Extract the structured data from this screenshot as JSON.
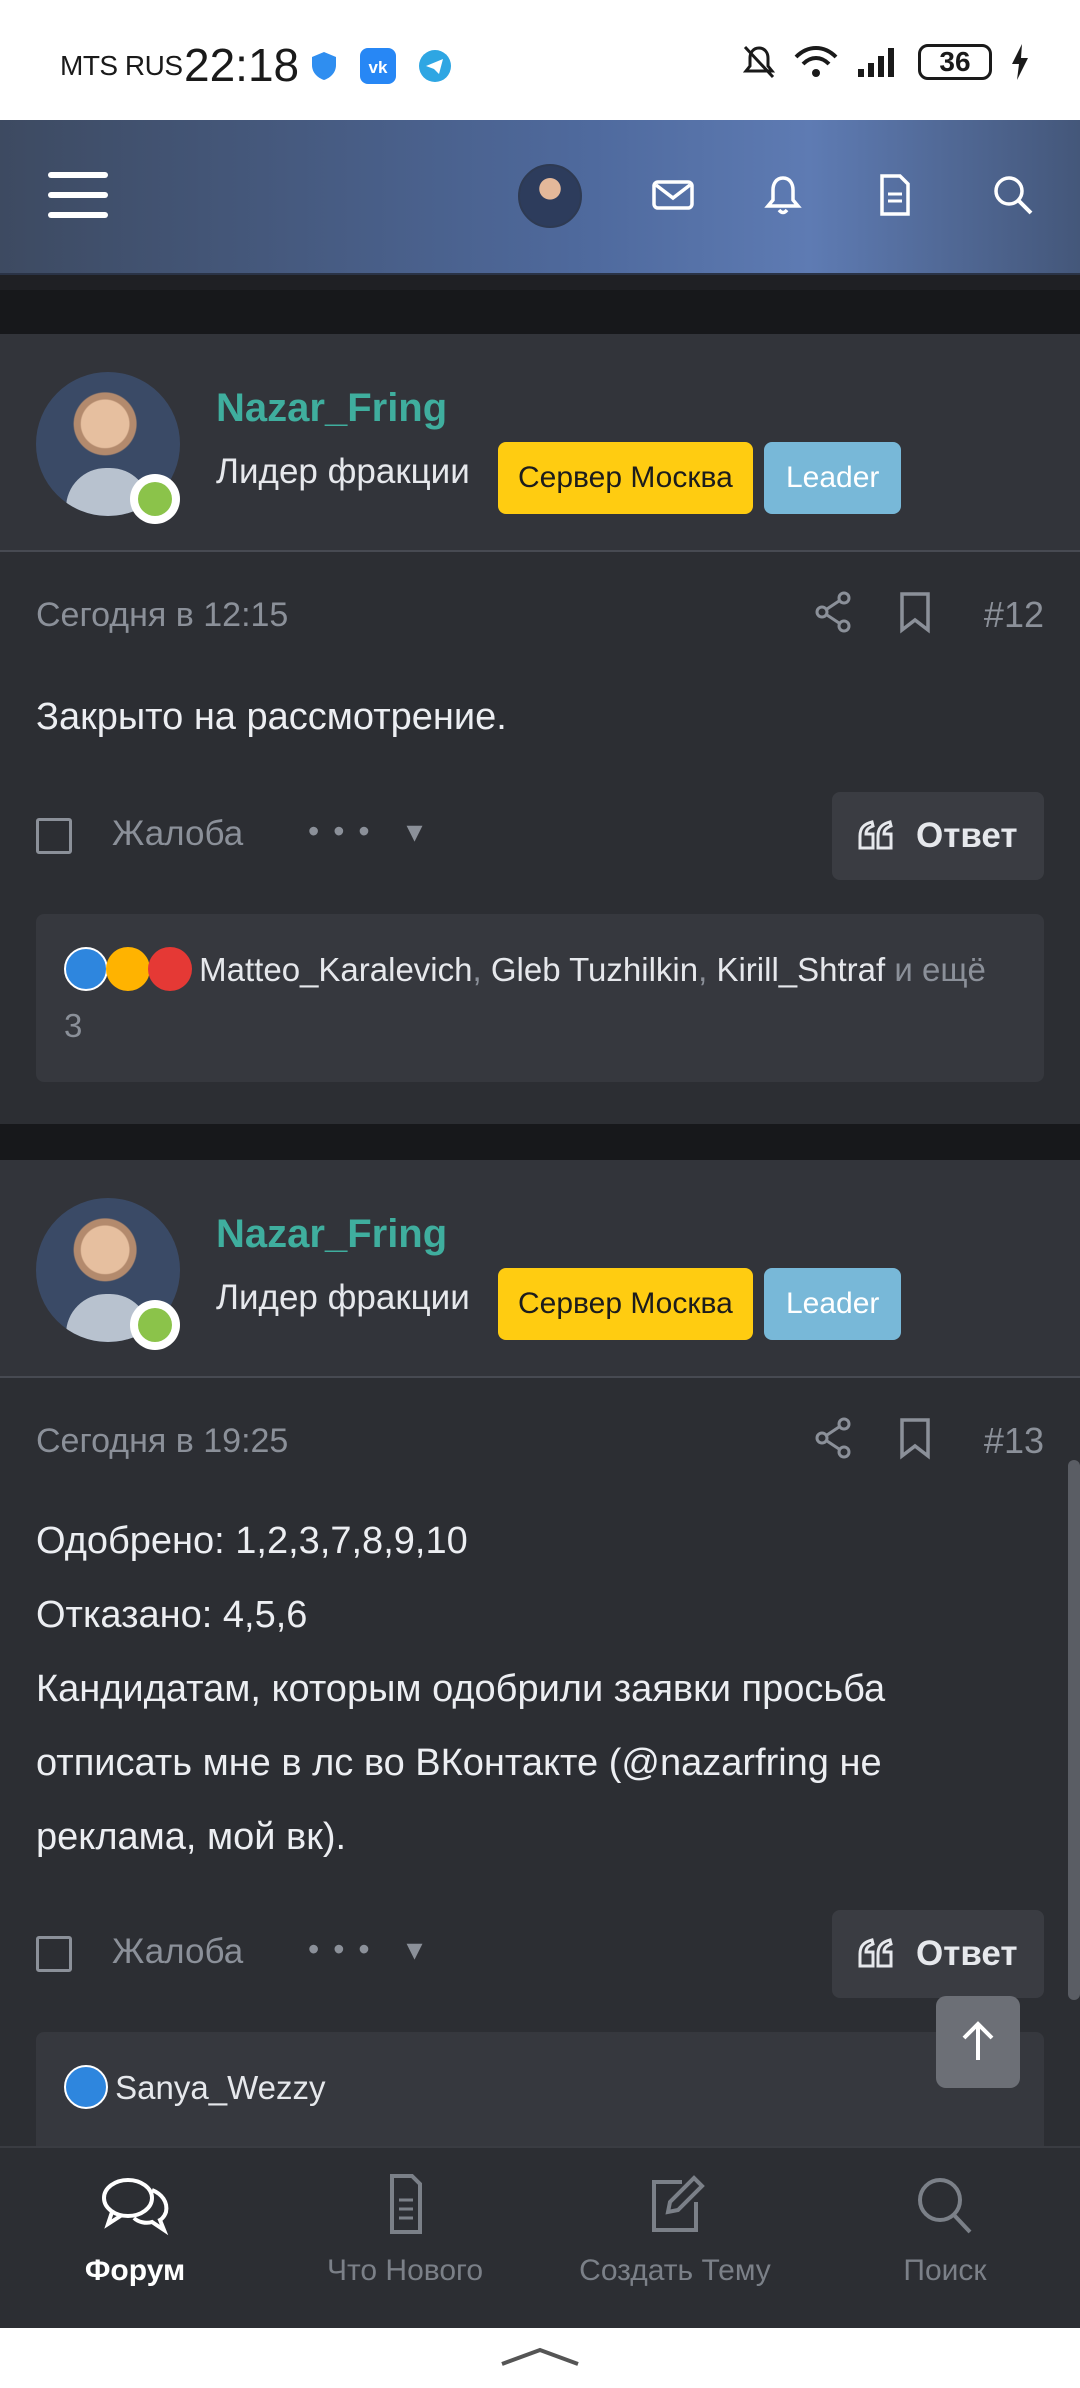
{
  "status_bar": {
    "carrier": "MTS RUS",
    "time": "22:18",
    "battery": "36"
  },
  "top_nav": {
    "icons": [
      "menu-icon",
      "avatar",
      "mail-icon",
      "bell-icon",
      "document-icon",
      "search-icon"
    ]
  },
  "posts": [
    {
      "username": "Nazar_Fring",
      "title": "Лидер фракции",
      "badge_server": "Сервер Москва",
      "badge_role": "Leader",
      "date": "Сегодня в 12:15",
      "number": "#12",
      "body": [
        "Закрыто на рассмотрение."
      ],
      "complaint_label": "Жалоба",
      "reply_label": "Ответ",
      "reactions": {
        "emojis": [
          "like",
          "love",
          "angry"
        ],
        "users": [
          "Matteo_Karalevich",
          "Gleb Tuzhilkin",
          "Kirill_Shtraf"
        ],
        "more_text": "и ещё 3"
      }
    },
    {
      "username": "Nazar_Fring",
      "title": "Лидер фракции",
      "badge_server": "Сервер Москва",
      "badge_role": "Leader",
      "date": "Сегодня в 19:25",
      "number": "#13",
      "body": [
        "Одобрено: 1,2,3,7,8,9,10",
        "Отказано: 4,5,6",
        "Кандидатам, которым одобрили заявки просьба",
        "отписать мне в лс во ВКонтакте (@nazarfring не",
        "реклама, мой вк)."
      ],
      "complaint_label": "Жалоба",
      "reply_label": "Ответ",
      "reactions": {
        "emojis": [
          "like"
        ],
        "users": [
          "Sanya_Wezzy"
        ]
      }
    }
  ],
  "bottom_nav": {
    "tabs": [
      {
        "label": "Форум",
        "icon": "chat-bubbles-icon",
        "active": true
      },
      {
        "label": "Что Нового",
        "icon": "document-icon",
        "active": false
      },
      {
        "label": "Создать Тему",
        "icon": "edit-icon",
        "active": false
      },
      {
        "label": "Поиск",
        "icon": "search-icon",
        "active": false
      }
    ]
  }
}
